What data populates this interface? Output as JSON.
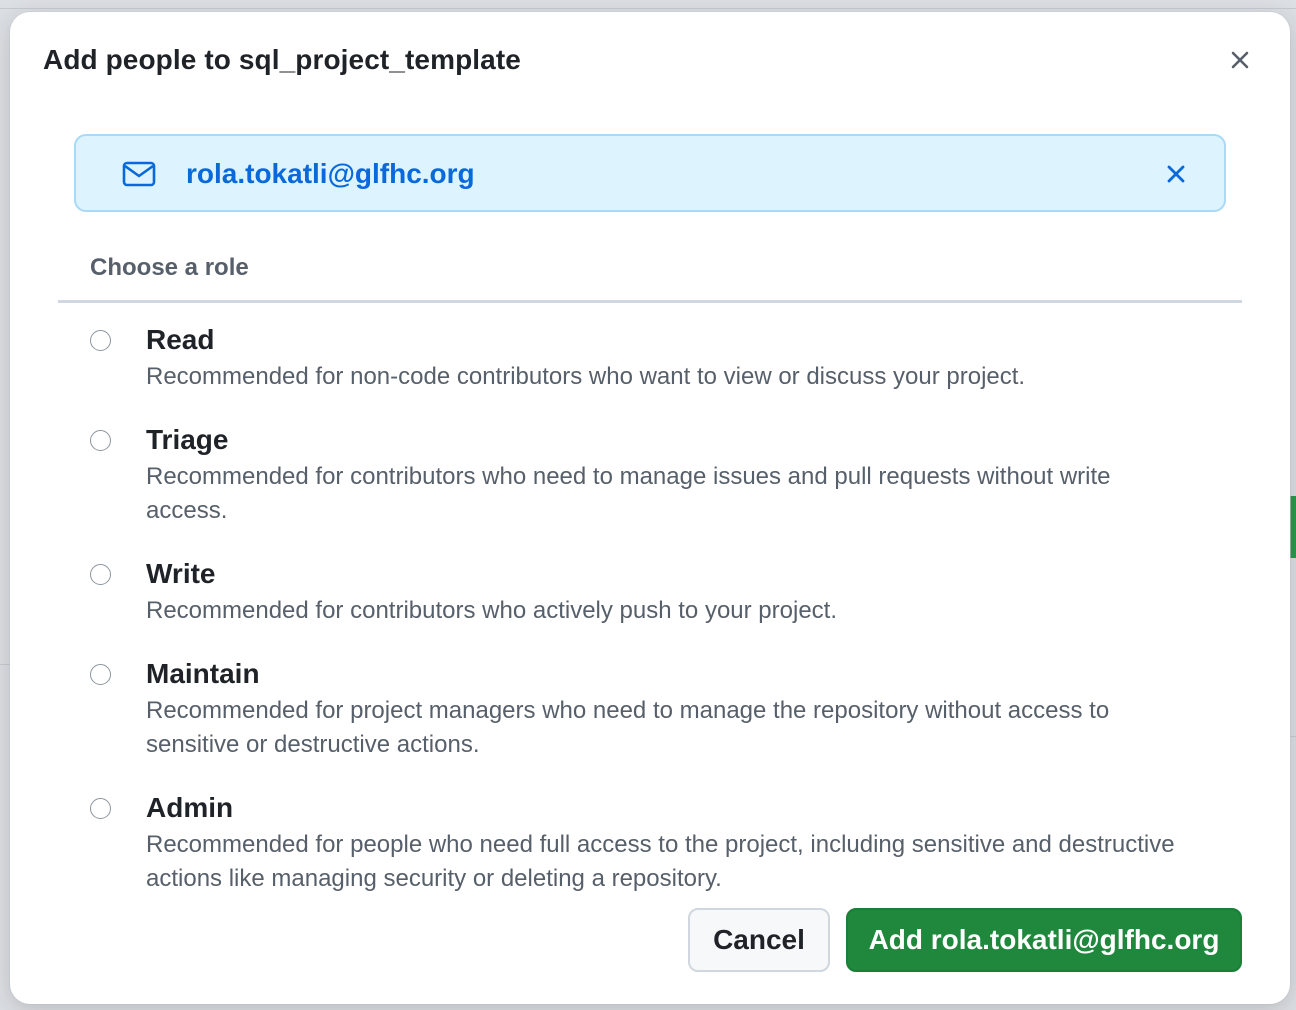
{
  "dialog": {
    "title": "Add people to sql_project_template",
    "close_icon": "close-icon"
  },
  "invitee": {
    "icon": "mail-icon",
    "email": "rola.tokatli@glfhc.org",
    "remove_icon": "close-icon"
  },
  "roles_section": {
    "header": "Choose a role",
    "roles": [
      {
        "name": "Read",
        "description": "Recommended for non-code contributors who want to view or discuss your project.",
        "selected": false
      },
      {
        "name": "Triage",
        "description": "Recommended for contributors who need to manage issues and pull requests without write access.",
        "selected": false
      },
      {
        "name": "Write",
        "description": "Recommended for contributors who actively push to your project.",
        "selected": false
      },
      {
        "name": "Maintain",
        "description": "Recommended for project managers who need to manage the repository without access to sensitive or destructive actions.",
        "selected": false
      },
      {
        "name": "Admin",
        "description": "Recommended for people who need full access to the project, including sensitive and destructive actions like managing security or deleting a repository.",
        "selected": false
      }
    ]
  },
  "actions": {
    "cancel_label": "Cancel",
    "add_label": "Add rola.tokatli@glfhc.org"
  },
  "colors": {
    "primary_button": "#1f883d",
    "link": "#0969da",
    "invitee_background": "#ddf4ff"
  }
}
